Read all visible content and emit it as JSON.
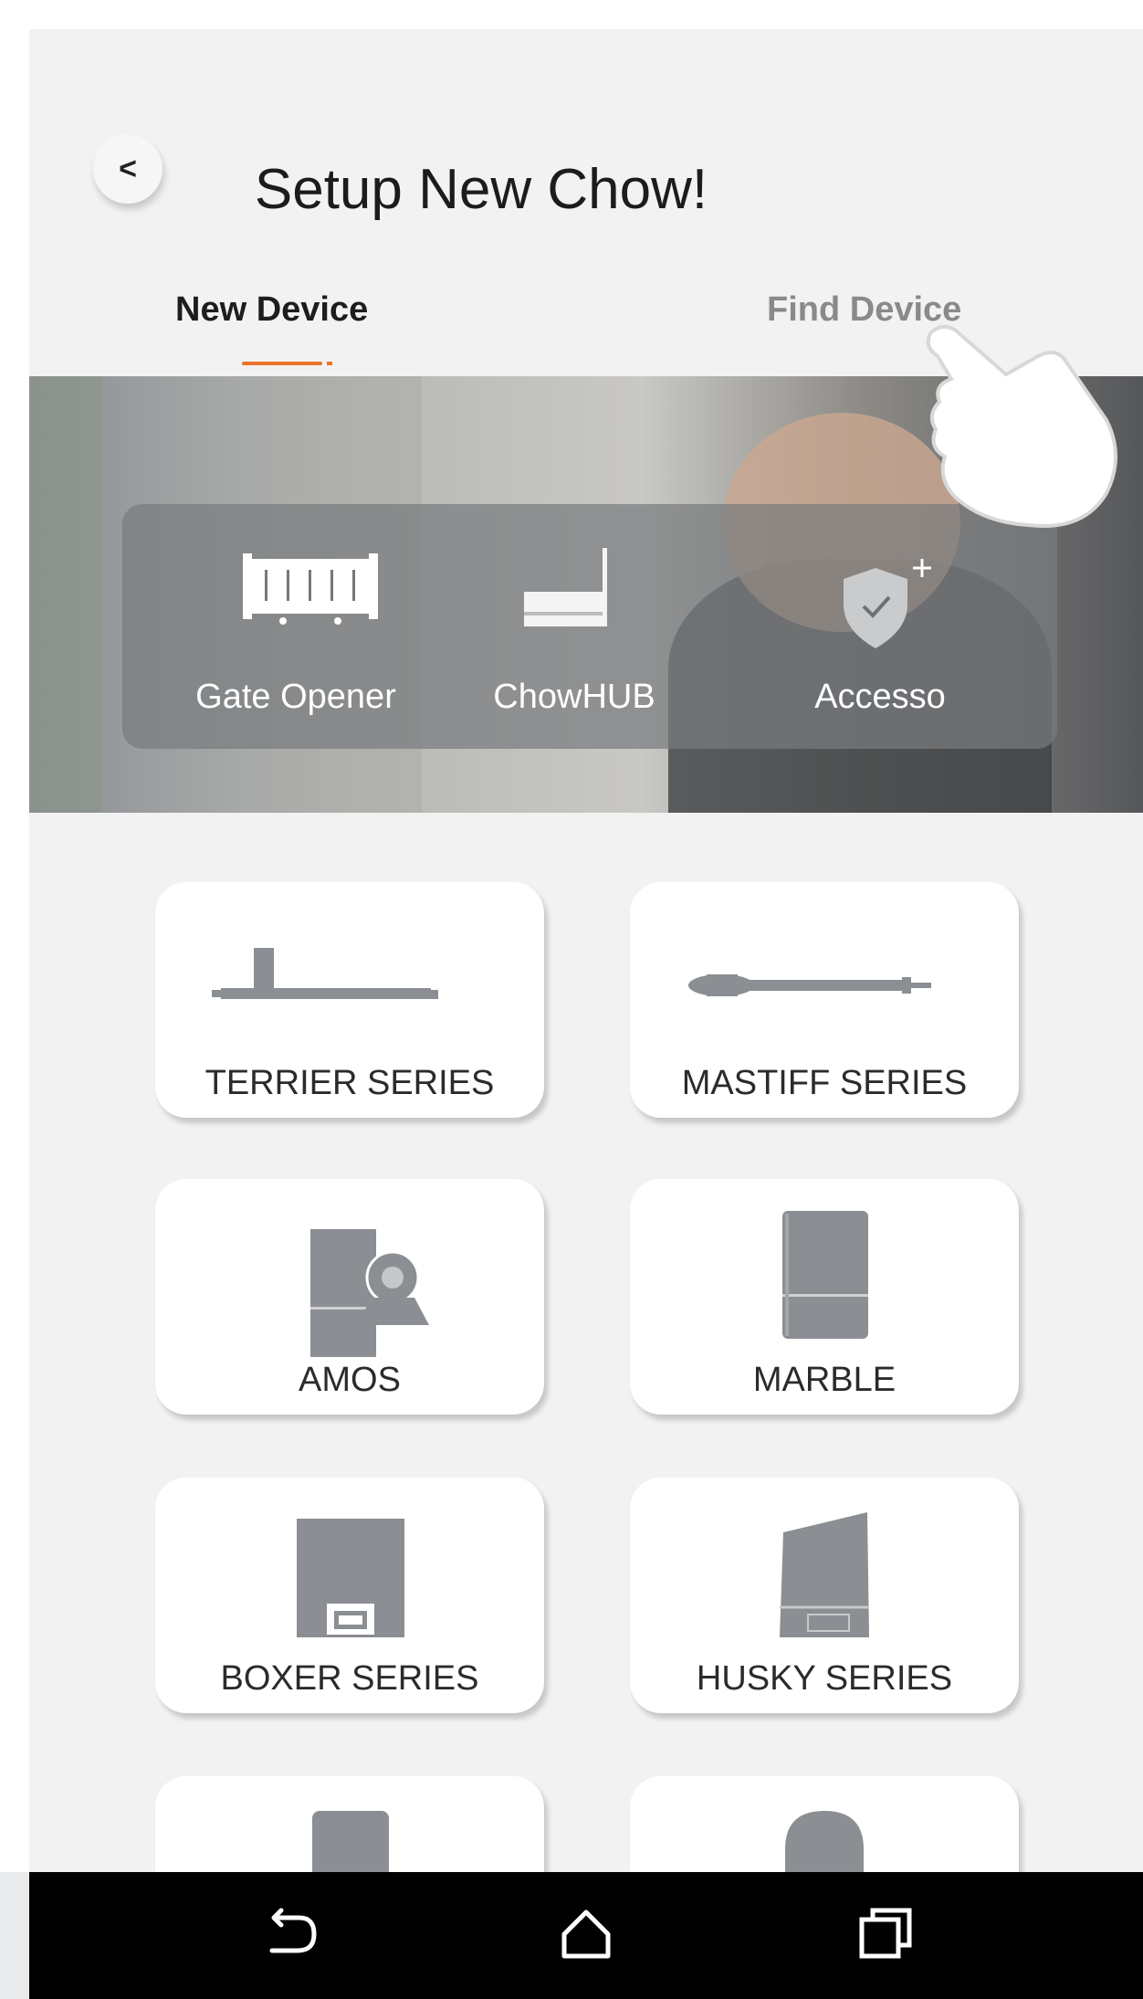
{
  "header": {
    "back_label": "<",
    "title": "Setup New Chow!"
  },
  "tabs": [
    {
      "label": "New Device",
      "active": true
    },
    {
      "label": "Find Device",
      "active": false
    }
  ],
  "accent_color": "#e8742a",
  "categories": [
    {
      "label": "Gate Opener",
      "icon": "gate-icon"
    },
    {
      "label": "ChowHUB",
      "icon": "hub-icon"
    },
    {
      "label": "Accesso",
      "icon": "shield-plus-icon"
    }
  ],
  "devices": [
    {
      "label": "TERRIER SERIES",
      "icon": "terrier-arm-icon"
    },
    {
      "label": "MASTIFF SERIES",
      "icon": "mastiff-arm-icon"
    },
    {
      "label": "AMOS",
      "icon": "amos-camera-icon"
    },
    {
      "label": "MARBLE",
      "icon": "marble-box-icon"
    },
    {
      "label": "BOXER SERIES",
      "icon": "boxer-box-icon"
    },
    {
      "label": "HUSKY SERIES",
      "icon": "husky-box-icon"
    },
    {
      "label": "",
      "icon": "post-icon"
    },
    {
      "label": "",
      "icon": "arch-icon"
    }
  ],
  "navbar": {
    "back": "back-icon",
    "home": "home-icon",
    "recents": "recents-icon"
  }
}
